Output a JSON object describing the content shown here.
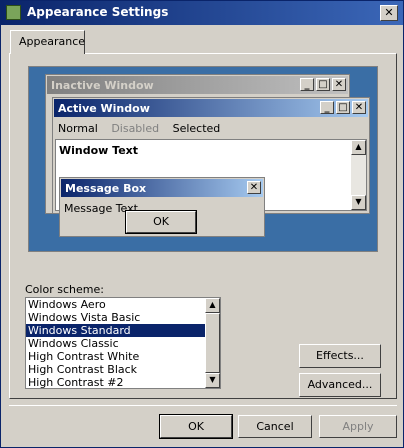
{
  "window": {
    "title": "Appearance Settings",
    "close_label": "✕"
  },
  "tabs": [
    {
      "label": "Appearance"
    }
  ],
  "preview": {
    "inactive_window": {
      "title": "Inactive Window"
    },
    "active_window": {
      "title": "Active Window",
      "menu": {
        "normal": "Normal",
        "disabled": "Disabled",
        "selected": "Selected"
      },
      "window_text": "Window Text"
    },
    "message_box": {
      "title": "Message Box",
      "text": "Message Text",
      "ok_label": "OK"
    },
    "controls": {
      "minimize": "_",
      "maximize": "□",
      "close": "✕",
      "scroll_up": "▲",
      "scroll_down": "▼"
    }
  },
  "color_scheme": {
    "label": "Color scheme:",
    "options": [
      "Windows Aero",
      "Windows Vista Basic",
      "Windows Standard",
      "Windows Classic",
      "High Contrast White",
      "High Contrast Black",
      "High Contrast #2"
    ],
    "selected": "Windows Standard"
  },
  "buttons": {
    "effects": "Effects...",
    "advanced": "Advanced...",
    "ok": "OK",
    "cancel": "Cancel",
    "apply": "Apply"
  },
  "colors": {
    "face": "#d4d0c8",
    "active_title": "#0a246a",
    "desktop": "#3a6ea5"
  }
}
